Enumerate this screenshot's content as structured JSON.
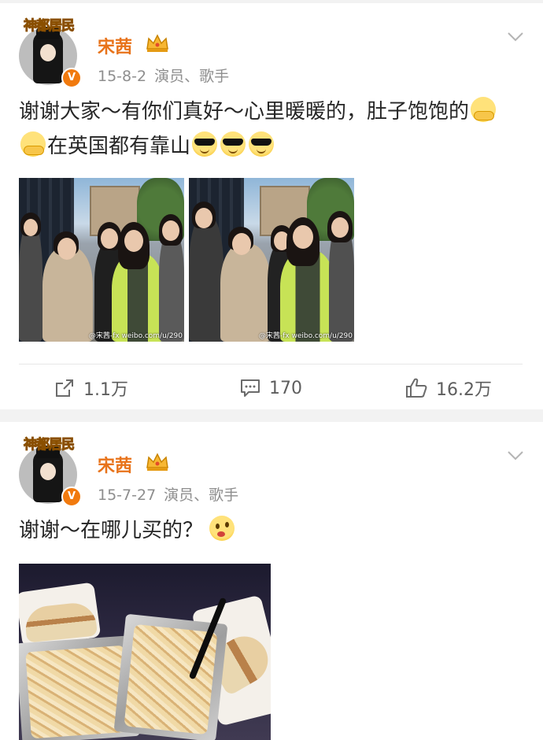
{
  "posts": [
    {
      "avatar_logo": "神都居民",
      "username": "宋茜",
      "date": "15-8-2",
      "tags": "演员、歌手",
      "text_parts": [
        "谢谢大家～有你们真好～心里暖暖的，肚子饱饱的",
        "在英国都有靠山"
      ],
      "emoji_names": [
        "hug-emoji",
        "hug-emoji",
        "cool-emoji",
        "cool-emoji",
        "cool-emoji"
      ],
      "image_watermark": "@宋茜-fx weibo.com/u/290",
      "actions": {
        "repost": "1.1万",
        "comment": "170",
        "like": "16.2万"
      }
    },
    {
      "avatar_logo": "神都居民",
      "username": "宋茜",
      "date": "15-7-27",
      "tags": "演员、歌手",
      "text": "谢谢～在哪儿买的？",
      "emoji_names": [
        "wonder-emoji"
      ]
    }
  ],
  "colors": {
    "username": "#e8731a",
    "meta": "#8e8e8e",
    "background": "#f2f2f2",
    "badge": "#f17a0e"
  },
  "icons": [
    "vip-crown-icon",
    "chevron-down-icon",
    "repost-icon",
    "comment-icon",
    "like-icon",
    "verified-badge-icon"
  ]
}
